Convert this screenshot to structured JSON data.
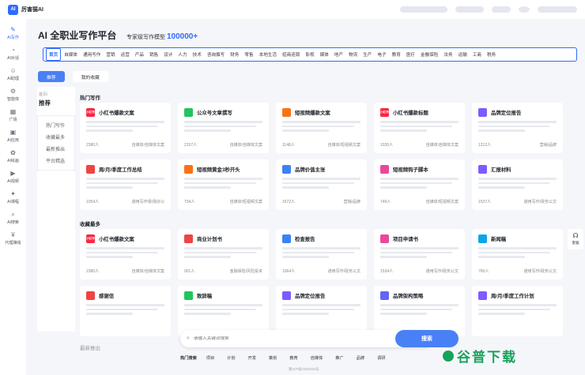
{
  "app": {
    "logo_text": "AI",
    "brand": "厉害猫AI"
  },
  "sidebar": [
    {
      "label": "AI写作",
      "icon": "✎",
      "icon_name": "pen-icon",
      "active": true
    },
    {
      "label": "AI对话",
      "icon": "◔",
      "icon_name": "chat-icon"
    },
    {
      "label": "AI助理",
      "icon": "☺",
      "icon_name": "assistant-icon"
    },
    {
      "label": "智能体",
      "icon": "⚙",
      "icon_name": "agent-icon"
    },
    {
      "label": "广场",
      "icon": "▦",
      "icon_name": "plaza-icon"
    },
    {
      "label": "AI应用",
      "icon": "▣",
      "icon_name": "apps-icon"
    },
    {
      "label": "AI绘画",
      "icon": "✿",
      "icon_name": "paint-icon"
    },
    {
      "label": "AI视频",
      "icon": "▶",
      "icon_name": "video-icon"
    },
    {
      "label": "AI课程",
      "icon": "✦",
      "icon_name": "course-icon"
    },
    {
      "label": "AI搜索",
      "icon": "⌕",
      "icon_name": "search-icon"
    },
    {
      "label": "代理赚钱",
      "icon": "¥",
      "icon_name": "money-icon"
    }
  ],
  "header": {
    "title": "AI 全职业写作平台",
    "subtitle": "专家级写作模型",
    "highlight": "100000+"
  },
  "categories": [
    "首页",
    "自媒体",
    "通用写作",
    "营销",
    "运营",
    "产品",
    "销售",
    "设计",
    "人力",
    "技术",
    "咨询撰写",
    "财务",
    "零售",
    "本地生活",
    "招商连锁",
    "影视",
    "媒体",
    "地产",
    "物流",
    "生产",
    "电子",
    "教育",
    "医疗",
    "金融保险",
    "法务",
    "运输",
    "工商",
    "税务"
  ],
  "tabs": {
    "recommend": "推荐",
    "favorites": "我的收藏"
  },
  "left_panel": {
    "crumb": "首页/",
    "heading": "推荐",
    "items": [
      "热门写作",
      "收藏最多",
      "最新推出",
      "平台精选"
    ]
  },
  "sections": {
    "hot": "热门写作",
    "fav": "收藏最多",
    "latest": "最新推出"
  },
  "hot_cards": [
    {
      "title": "小红书爆款文案",
      "icon_text": "小红书",
      "color": "#ff2442",
      "count": "2380人",
      "tag": "自媒体/自媒体文案"
    },
    {
      "title": "公众号文章撰写",
      "icon_text": "",
      "color": "#22c55e",
      "count": "2157人",
      "tag": "自媒体/自媒体文案"
    },
    {
      "title": "短视频爆款文案",
      "icon_text": "",
      "color": "#f97316",
      "count": "1148人",
      "tag": "自媒体/短视频文案"
    },
    {
      "title": "小红书爆款标题",
      "icon_text": "小红书",
      "color": "#ff2442",
      "count": "1035人",
      "tag": "自媒体/自媒体文案"
    },
    {
      "title": "品牌定位报告",
      "icon_text": "",
      "color": "#7c5cff",
      "count": "1212人",
      "tag": "营销/品牌"
    },
    {
      "title": "周/月/季度工作总结",
      "icon_text": "",
      "color": "#ef4444",
      "count": "1054人",
      "tag": "通用写作/职场办公"
    },
    {
      "title": "短视频黄金3秒开头",
      "icon_text": "",
      "color": "#f97316",
      "count": "734人",
      "tag": "自媒体/短视频文案"
    },
    {
      "title": "品牌价值主张",
      "icon_text": "",
      "color": "#3b82f6",
      "count": "1572人",
      "tag": "营销/品牌"
    },
    {
      "title": "短视频钩子脚本",
      "icon_text": "",
      "color": "#ec4899",
      "count": "749人",
      "tag": "自媒体/短视频文案"
    },
    {
      "title": "汇报材料",
      "icon_text": "",
      "color": "#7c5cff",
      "count": "1537人",
      "tag": "通用写作/政务公文"
    }
  ],
  "fav_cards": [
    {
      "title": "小红书爆款文案",
      "icon_text": "小红书",
      "color": "#ff2442",
      "count": "2380人",
      "tag": "自媒体/自媒体文案"
    },
    {
      "title": "商业计划书",
      "icon_text": "",
      "color": "#ef4444",
      "count": "901人",
      "tag": "金融保险/风险投资"
    },
    {
      "title": "检查报告",
      "icon_text": "",
      "color": "#3b82f6",
      "count": "1064人",
      "tag": "通用写作/政务公文"
    },
    {
      "title": "项目申请书",
      "icon_text": "",
      "color": "#ec4899",
      "count": "1534人",
      "tag": "通用写作/政务公文"
    },
    {
      "title": "新闻稿",
      "icon_text": "",
      "color": "#0ea5e9",
      "count": "765人",
      "tag": "通用写作/政务公文"
    },
    {
      "title": "感谢信",
      "icon_text": "",
      "color": "#ef4444",
      "count": "",
      "tag": ""
    },
    {
      "title": "致辞稿",
      "icon_text": "",
      "color": "#22c55e",
      "count": "",
      "tag": ""
    },
    {
      "title": "品牌定位报告",
      "icon_text": "",
      "color": "#7c5cff",
      "count": "",
      "tag": ""
    },
    {
      "title": "品牌架构策略",
      "icon_text": "",
      "color": "#6366f1",
      "count": "",
      "tag": ""
    },
    {
      "title": "周/月/季度工作计划",
      "icon_text": "",
      "color": "#7c5cff",
      "count": "",
      "tag": ""
    }
  ],
  "search": {
    "placeholder": "请输入关键词搜索",
    "button": "搜索"
  },
  "hot_search": {
    "label": "热门搜索",
    "items": [
      "项目",
      "计划",
      "开发",
      "策划",
      "教育",
      "自媒体",
      "推广",
      "品牌",
      "调研"
    ]
  },
  "service": {
    "label": "客服",
    "icon": "☊"
  },
  "icp": "蜀ICP备2302815号",
  "watermark": "谷普下载"
}
